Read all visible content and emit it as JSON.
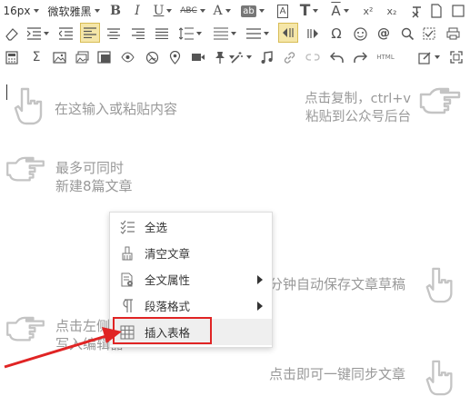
{
  "toolbar": {
    "font_size": "16px",
    "font_family": "微软雅黑",
    "bold_label": "B",
    "italic_label": "I",
    "underline_label": "U",
    "strike_label": "ABC",
    "font_color_label": "A",
    "bg_color_label": "ab",
    "font_border_label": "A",
    "text_t_label": "T",
    "text_size_label": "A",
    "sup_label": "x²",
    "sub_label": "x₂",
    "html_label": "HTML",
    "active_align": "align-left",
    "active_color": "#f5e6a8"
  },
  "editor": {
    "hints": [
      {
        "lines": [
          "在这输入或粘贴内容"
        ]
      },
      {
        "lines": [
          "点击复制，ctrl+v",
          "粘贴到公众号后台"
        ]
      },
      {
        "lines": [
          "最多可同时",
          "新建8篇文章"
        ]
      },
      {
        "lines": [
          "分钟自动保存文章草稿"
        ]
      },
      {
        "lines": [
          "点击左侧",
          "写入编辑器"
        ]
      },
      {
        "lines": [
          "点击即可一键同步文章"
        ]
      }
    ]
  },
  "context_menu": {
    "items": [
      {
        "label": "全选",
        "icon": "list-check-icon",
        "submenu": false
      },
      {
        "label": "清空文章",
        "icon": "broom-icon",
        "submenu": false
      },
      {
        "label": "全文属性",
        "icon": "document-gear-icon",
        "submenu": true
      },
      {
        "label": "段落格式",
        "icon": "paragraph-icon",
        "submenu": true
      },
      {
        "label": "插入表格",
        "icon": "table-icon",
        "submenu": false
      }
    ],
    "highlighted_item": "插入表格",
    "highlight_color": "#e02424"
  }
}
